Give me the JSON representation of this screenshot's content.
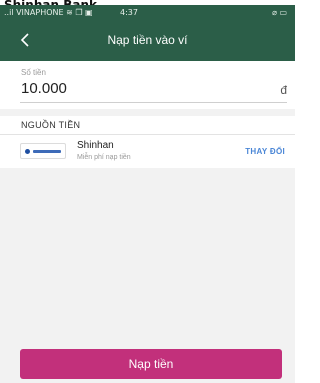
{
  "caption": "Shinhan Bank",
  "status_bar": {
    "carrier": "..il VINAPHONE ≋ ❒ ▣",
    "time": "4:37",
    "system": "⌀ ▭"
  },
  "app_bar": {
    "back_icon": "chevron-left-icon",
    "title": "Nạp tiền vào ví"
  },
  "amount": {
    "label": "Số tiền",
    "value": "10.000",
    "currency": "đ"
  },
  "funding_source": {
    "heading": "NGUỒN TIỀN",
    "bank_name": "Shinhan",
    "fee_note": "Miễn phí nạp tiền",
    "change_label": "THAY ĐỔI"
  },
  "submit": {
    "label": "Nạp tiền",
    "color": "#c2307b"
  },
  "colors": {
    "header": "#2b5e48",
    "accent_link": "#4a86d6"
  }
}
